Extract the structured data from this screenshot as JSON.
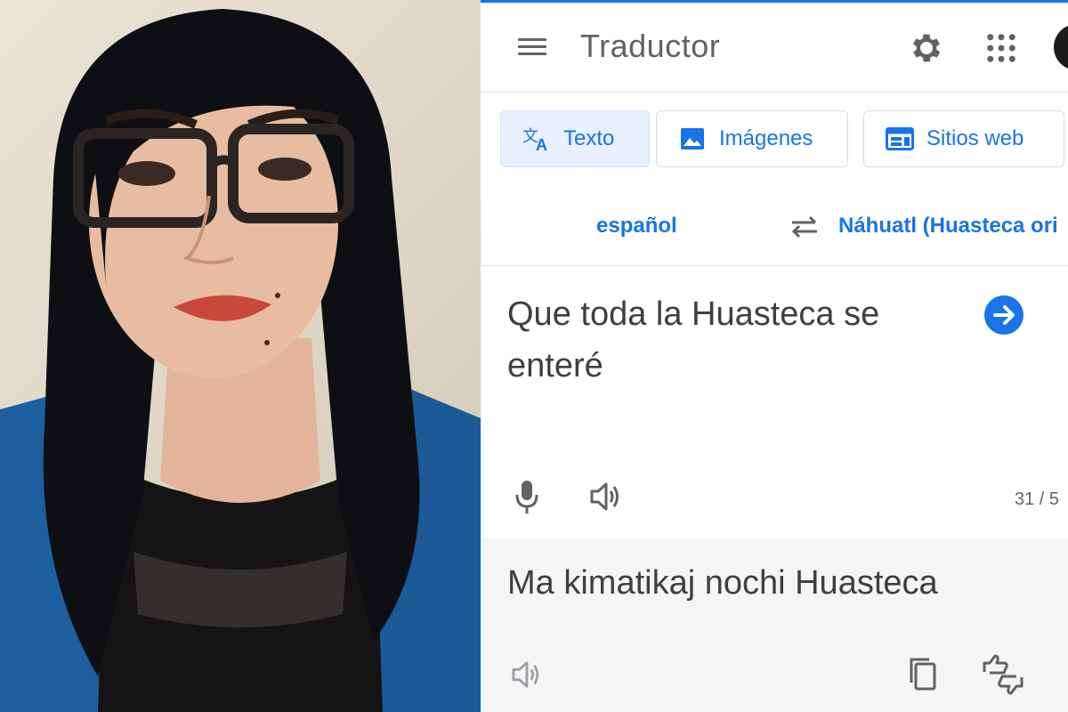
{
  "app": {
    "title": "Traductor",
    "accent_color": "#1a73e8",
    "icons": {
      "menu": "menu-icon",
      "settings": "gear-icon",
      "apps": "apps-grid-icon",
      "account": "avatar"
    }
  },
  "tabs": [
    {
      "label": "Texto",
      "icon": "translate-icon",
      "active": true
    },
    {
      "label": "Imágenes",
      "icon": "image-icon",
      "active": false
    },
    {
      "label": "Sitios web",
      "icon": "web-icon",
      "active": false
    }
  ],
  "languages": {
    "source": "español",
    "target": "Náhuatl (Huasteca ori"
  },
  "input": {
    "text": "Que toda la Huasteca se enteré",
    "char_count": "31 / 5"
  },
  "output": {
    "text": "Ma kimatikaj nochi Huasteca"
  }
}
